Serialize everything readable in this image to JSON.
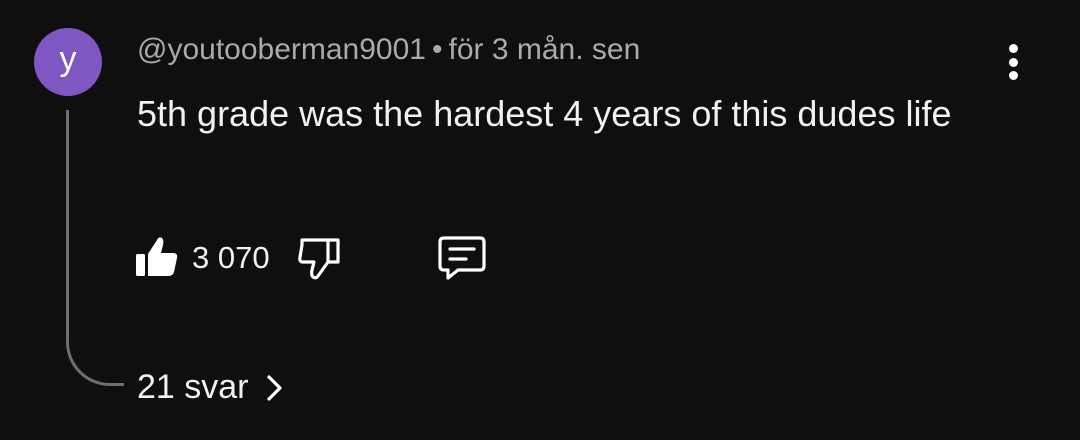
{
  "comment": {
    "avatar_letter": "y",
    "avatar_color": "#7e57c2",
    "author": "@youtooberman9001",
    "separator": "•",
    "timestamp": "för 3 mån. sen",
    "text": "5th grade was the hardest 4 years of this dudes life",
    "like_count": "3 070",
    "replies_label": "21 svar",
    "icons": {
      "more": "more-vert-icon",
      "like": "thumbs-up-filled-icon",
      "dislike": "thumbs-down-outline-icon",
      "reply": "reply-comment-icon",
      "replies_chevron": "chevron-right-icon"
    }
  }
}
